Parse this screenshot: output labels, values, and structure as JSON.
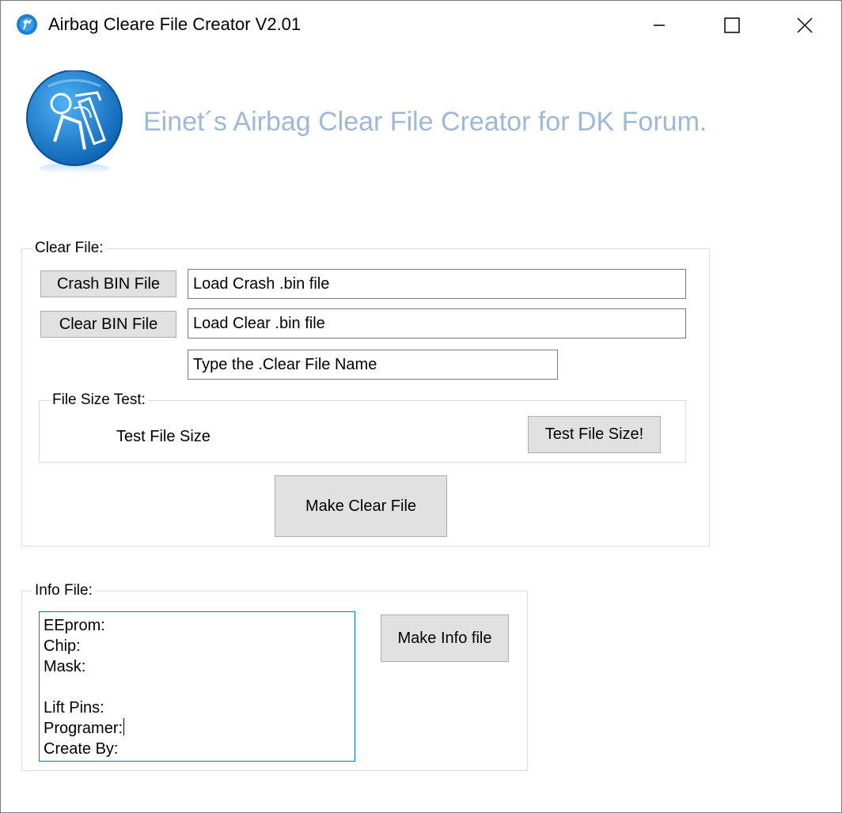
{
  "window": {
    "title": "Airbag Cleare File Creator V2.01",
    "controls": {
      "minimize": "minimize",
      "maximize": "maximize",
      "close": "close"
    }
  },
  "banner": {
    "text": "Einet´s Airbag Clear File Creator for DK Forum.",
    "text_color": "#9fb8d6",
    "logo_icon": "airbag-logo-icon"
  },
  "clear_file": {
    "legend": "Clear File:",
    "crash_button": "Crash BIN File",
    "crash_field": "Load Crash .bin file",
    "clear_button": "Clear BIN File",
    "clear_field": "Load Clear .bin file",
    "name_field": "Type the .Clear File Name",
    "size_test": {
      "legend": "File Size Test:",
      "label": "Test File Size",
      "button": "Test File Size!"
    },
    "make_button": "Make Clear File"
  },
  "info_file": {
    "legend": "Info File:",
    "lines": [
      "EEprom:",
      "Chip:",
      "Mask:",
      "",
      "Lift Pins:",
      "Programer:",
      "Create By:"
    ],
    "make_button": "Make Info file"
  },
  "colors": {
    "button_bg": "#e1e1e1",
    "focus_border": "#0078d7"
  }
}
